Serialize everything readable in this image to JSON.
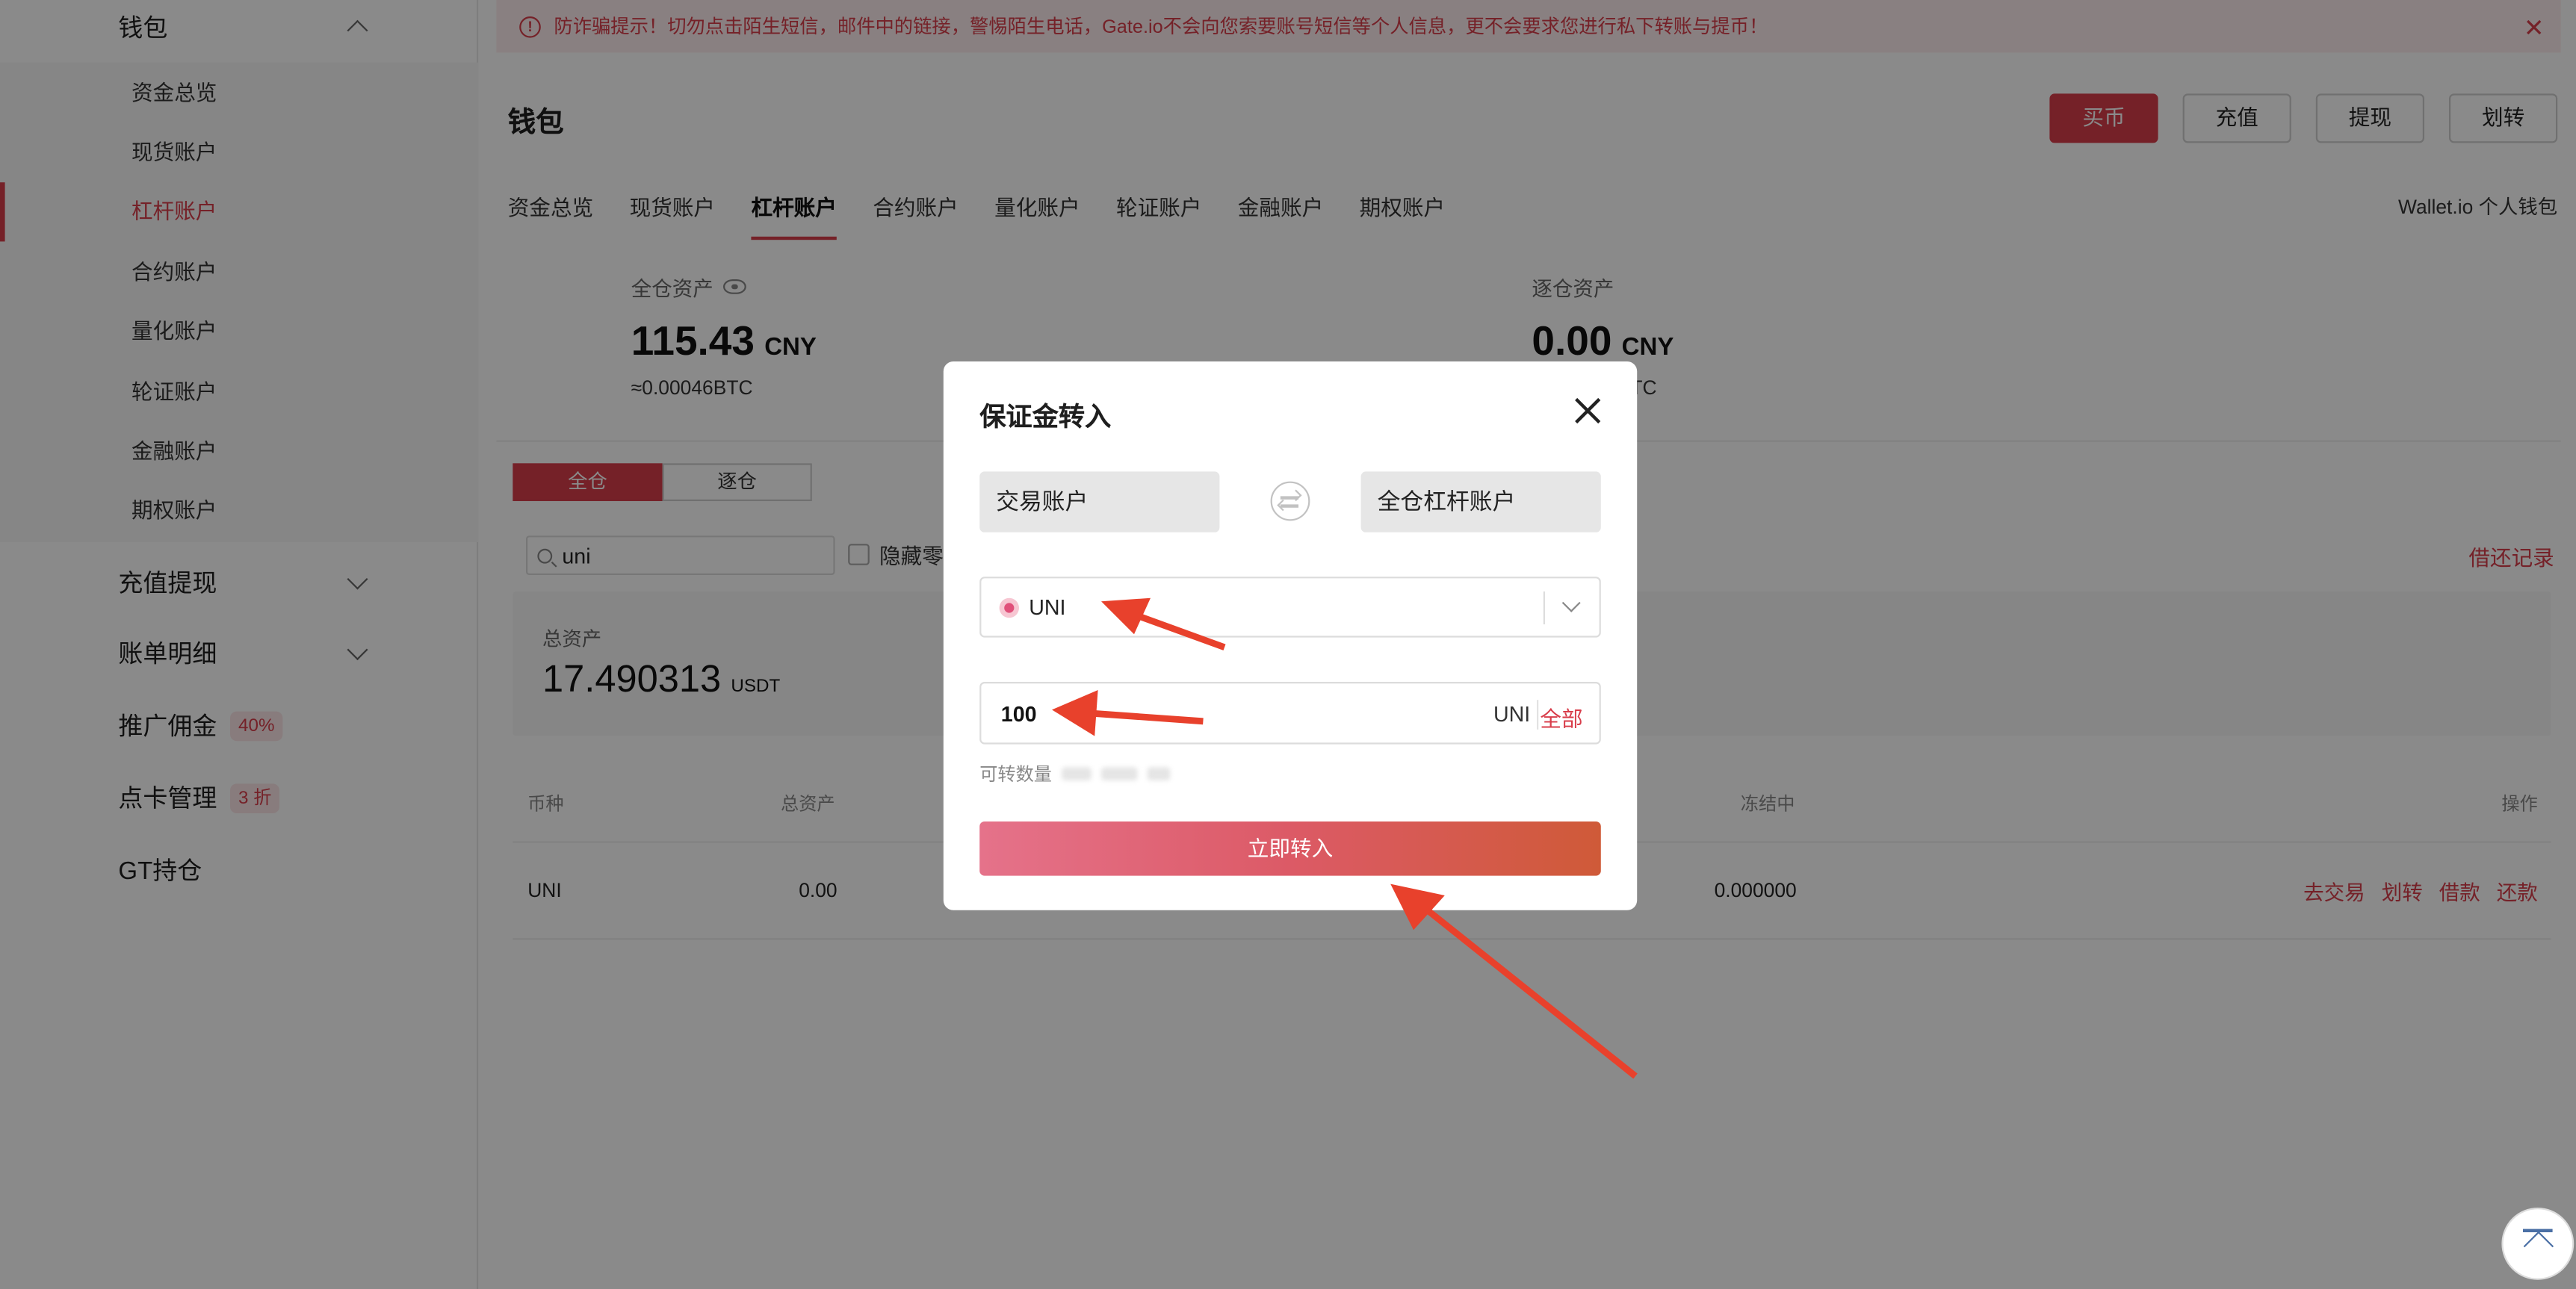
{
  "notice": {
    "text": "防诈骗提示！切勿点击陌生短信，邮件中的链接，警惕陌生电话，Gate.io不会向您索要账号短信等个人信息，更不会要求您进行私下转账与提币！",
    "close": "✕"
  },
  "sidebar": {
    "wallet": "钱包",
    "items": [
      {
        "label": "资金总览"
      },
      {
        "label": "现货账户"
      },
      {
        "label": "杠杆账户"
      },
      {
        "label": "合约账户"
      },
      {
        "label": "量化账户"
      },
      {
        "label": "轮证账户"
      },
      {
        "label": "金融账户"
      },
      {
        "label": "期权账户"
      }
    ],
    "deposit_withdraw": "充值提现",
    "bill_detail": "账单明细",
    "referral": "推广佣金",
    "referral_badge": "40%",
    "point_card": "点卡管理",
    "point_badge": "3 折",
    "gt": "GT持仓"
  },
  "header": {
    "title": "钱包",
    "buy": "买币",
    "deposit": "充值",
    "withdraw": "提现",
    "transfer": "划转"
  },
  "tabs": [
    "资金总览",
    "现货账户",
    "杠杆账户",
    "合约账户",
    "量化账户",
    "轮证账户",
    "金融账户",
    "期权账户"
  ],
  "wallet_link": "Wallet.io 个人钱包",
  "cross_assets": {
    "label": "全仓资产",
    "value": "115.43",
    "unit": "CNY",
    "btc": "≈0.00046BTC"
  },
  "isolated_assets": {
    "label": "逐仓资产",
    "value": "0.00",
    "unit": "CNY",
    "btc_tail": "TC"
  },
  "mode": {
    "cross": "全仓",
    "isolated": "逐仓"
  },
  "search": {
    "value": "uni"
  },
  "hide_zero": "隐藏零",
  "repay_record": "借还记录",
  "total": {
    "label": "总资产",
    "value": "17.490313",
    "unit": "USDT"
  },
  "table": {
    "headers": {
      "coin": "币种",
      "total": "总资产",
      "frozen": "冻结中",
      "ops": "操作"
    },
    "row": {
      "coin": "UNI",
      "total": "0.00",
      "frozen": "0.000000"
    },
    "ops": [
      "去交易",
      "划转",
      "借款",
      "还款"
    ]
  },
  "modal": {
    "title": "保证金转入",
    "from": "交易账户",
    "to": "全仓杠杆账户",
    "coin": "UNI",
    "amount": "100",
    "amount_unit": "UNI",
    "all": "全部",
    "available": "可转数量",
    "confirm": "立即转入"
  },
  "colors": {
    "accent": "#d83d4a",
    "arrow": "#e8412c"
  }
}
